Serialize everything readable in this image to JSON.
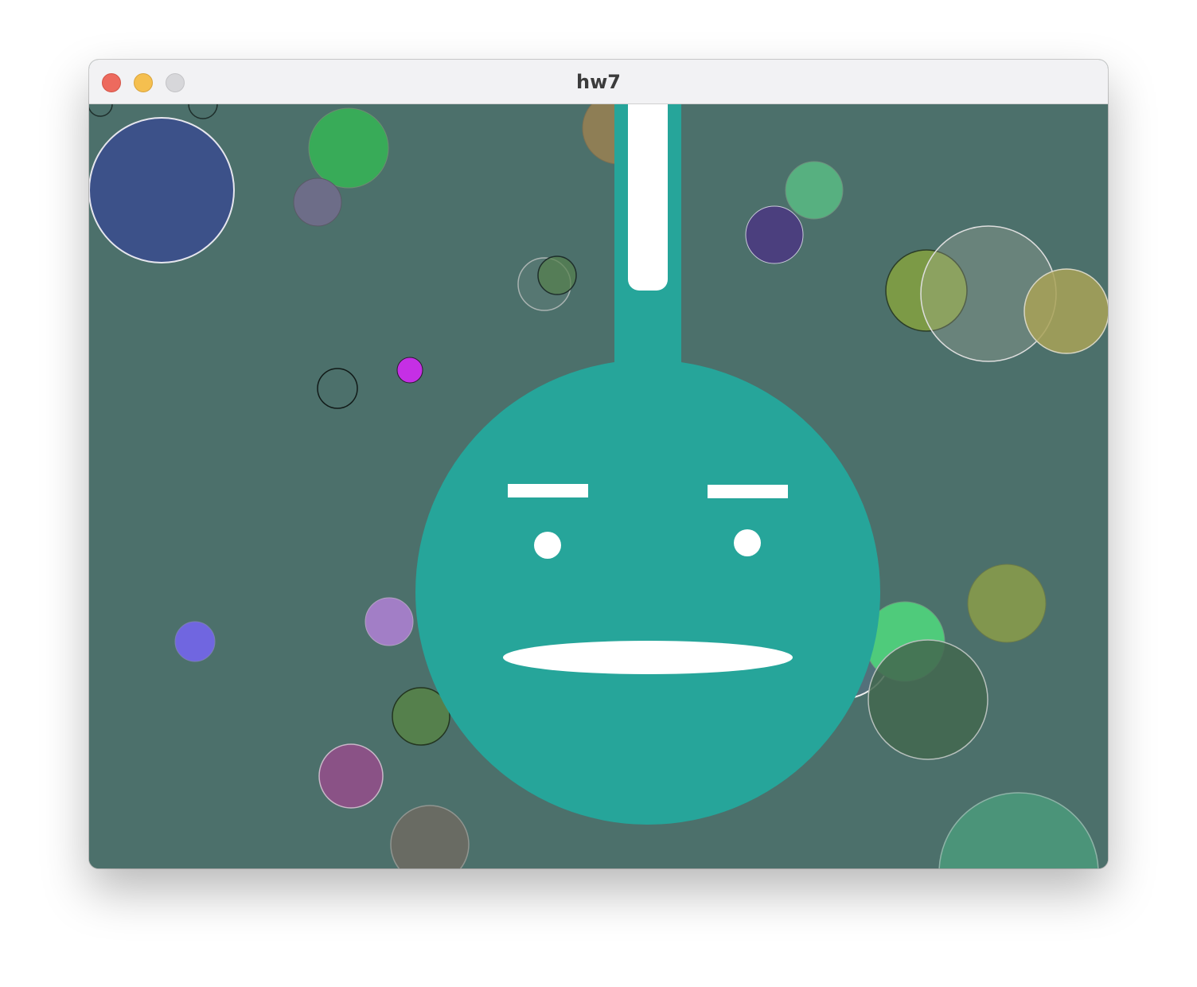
{
  "window": {
    "title": "hw7"
  },
  "colors": {
    "background": "#4c706b",
    "titlebar": "#f2f2f4",
    "character_body": "#26a59a",
    "character_features": "#ffffff",
    "close": "#ed6a5e",
    "minimize": "#f5bf4f",
    "zoom": "#d7d7da"
  },
  "character": {
    "expression": "neutral",
    "eye_count": 2,
    "eyebrow_count": 2
  },
  "bubbles": {
    "count": 32,
    "fills": [
      "#3c5189",
      "#38ab58",
      "#6d6d88",
      "#57b080",
      "#4b3f7e",
      "#7c9a46",
      "#9b9a50",
      "#c52fe5",
      "#7066e0",
      "#a27ec6",
      "#55804c",
      "#8a5286",
      "#696b63",
      "#4fcb7b",
      "#81964e",
      "#4b9479",
      "#8e7e55",
      "#43674f"
    ]
  }
}
